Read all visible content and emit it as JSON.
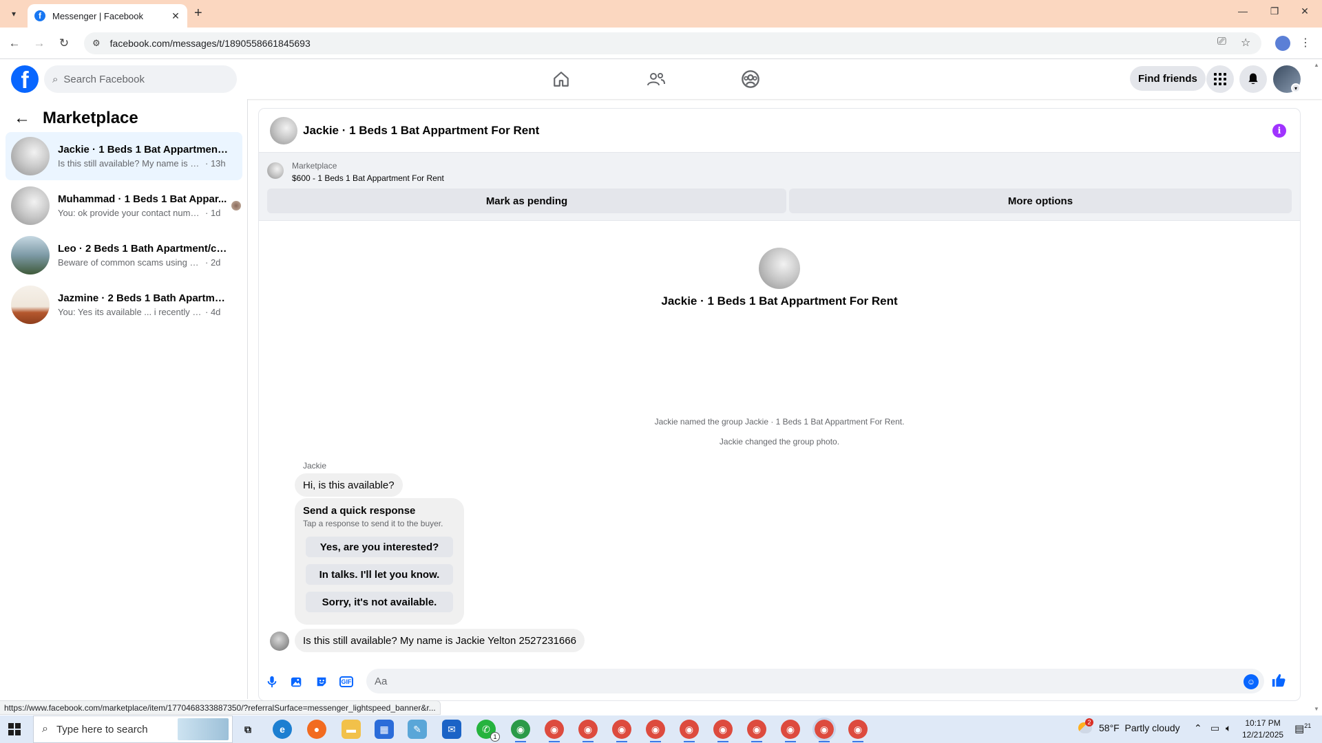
{
  "browser": {
    "tab_title": "Messenger | Facebook",
    "url": "facebook.com/messages/t/1890558661845693",
    "status_url": "https://www.facebook.com/marketplace/item/1770468333887350/?referralSurface=messenger_lightspeed_banner&r..."
  },
  "header": {
    "search_placeholder": "Search Facebook",
    "find_friends": "Find friends"
  },
  "sidebar": {
    "title": "Marketplace",
    "conversations": [
      {
        "name": "Jackie · 1 Beds 1 Bat Appartment F...",
        "preview": "Is this still available? My name is Jac...",
        "time": "· 13h"
      },
      {
        "name": "Muhammad · 1 Beds 1 Bat Appar...",
        "preview": "You: ok provide your contact numb...",
        "time": "· 1d"
      },
      {
        "name": "Leo · 2 Beds 1 Bath Apartment/con...",
        "preview": "Beware of common scams using pay...",
        "time": "· 2d"
      },
      {
        "name": "Jazmine · 2 Beds 1 Bath Apartment...",
        "preview": "You: Yes its available ... i recently share...",
        "time": "· 4d"
      }
    ]
  },
  "chat": {
    "title": "Jackie · 1 Beds 1 Bat Appartment For Rent",
    "listing": {
      "label": "Marketplace",
      "price_title": "$600 - 1 Beds 1 Bat Appartment For Rent",
      "mark_pending": "Mark as pending",
      "more_options": "More options"
    },
    "intro_title": "Jackie · 1 Beds 1 Bat Appartment For Rent",
    "system_messages": [
      "Jackie named the group Jackie · 1 Beds 1 Bat Appartment For Rent.",
      "Jackie changed the group photo."
    ],
    "sender": "Jackie",
    "first_message": "Hi, is this available?",
    "quick_response": {
      "title": "Send a quick response",
      "subtitle": "Tap a response to send it to the buyer.",
      "options": [
        "Yes, are you interested?",
        "In talks. I'll let you know.",
        "Sorry, it's not available."
      ]
    },
    "last_message": "Is this still available? My name is Jackie Yelton 2527231666",
    "composer_placeholder": "Aa"
  },
  "taskbar": {
    "search_text": "Type here to search",
    "weather": "58°F  Partly cloudy",
    "time": "10:17 PM",
    "date": "12/21/2025",
    "whatsapp_badge": "1",
    "weather_badge": "2",
    "notif_count": "21"
  },
  "colors": {
    "accent": "#0866ff",
    "tabstrip": "#fbd7c0",
    "info": "#a033ff"
  }
}
